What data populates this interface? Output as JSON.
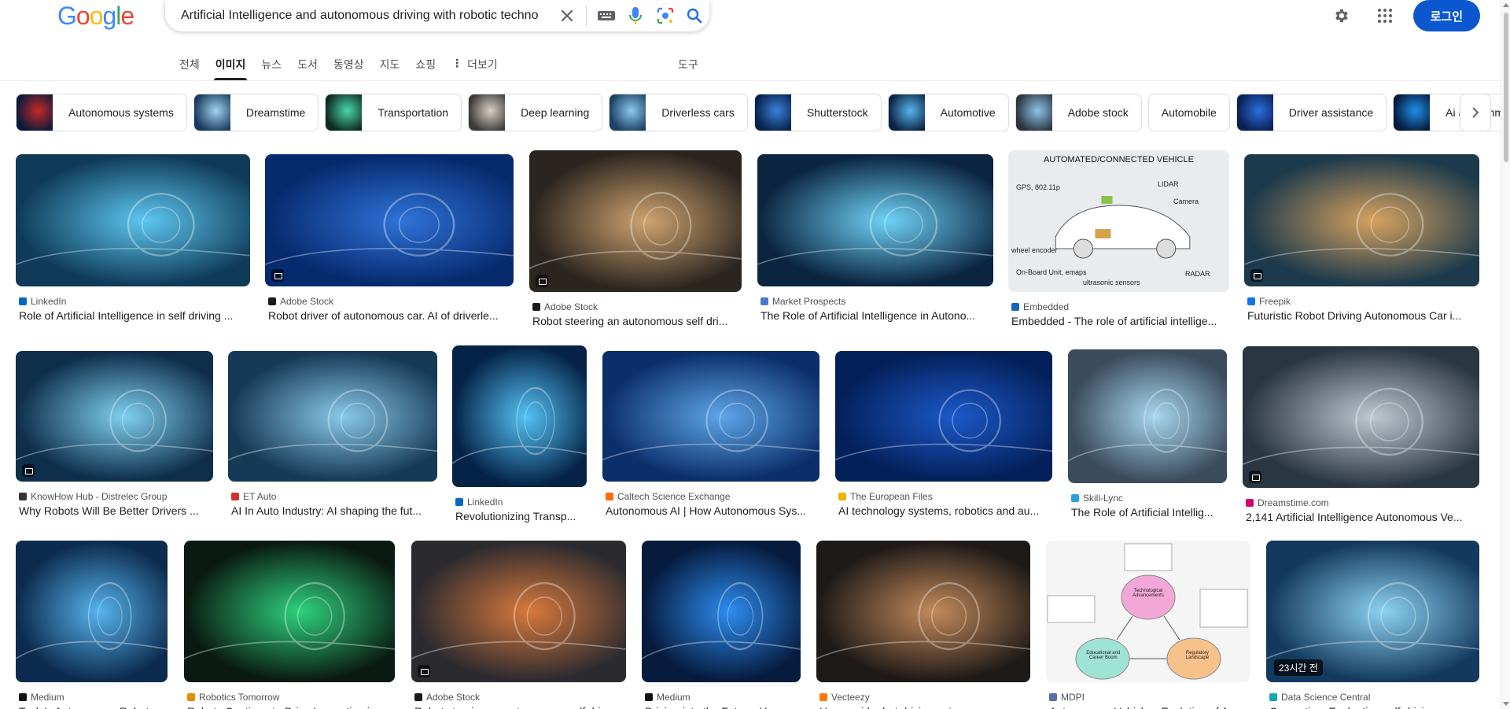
{
  "header": {
    "logo": "Google",
    "search_query": "Artificial Intelligence and autonomous driving with robotic techno",
    "login_label": "로그인"
  },
  "tabs": [
    "전체",
    "이미지",
    "뉴스",
    "도서",
    "동영상",
    "지도",
    "쇼핑",
    "더보기"
  ],
  "tools_label": "도구",
  "chips": [
    {
      "label": "Autonomous systems",
      "colors": [
        "#0b1a3a",
        "#c62828"
      ]
    },
    {
      "label": "Dreamstime",
      "colors": [
        "#1a3a5c",
        "#9fd3f0"
      ]
    },
    {
      "label": "Transportation",
      "colors": [
        "#0d2a22",
        "#4bd7a8"
      ]
    },
    {
      "label": "Deep learning",
      "colors": [
        "#3a3a3a",
        "#d9d2c4"
      ]
    },
    {
      "label": "Driverless cars",
      "colors": [
        "#1c3f63",
        "#8ac9ef"
      ]
    },
    {
      "label": "Shutterstock",
      "colors": [
        "#06214a",
        "#3b7fd9"
      ]
    },
    {
      "label": "Automotive",
      "colors": [
        "#0b2244",
        "#59b6ec"
      ]
    },
    {
      "label": "Adobe stock",
      "colors": [
        "#2a3440",
        "#8fc3e8"
      ]
    },
    {
      "label": "Automobile",
      "colors": null
    },
    {
      "label": "Driver assistance",
      "colors": [
        "#0a1f52",
        "#2a6fe0"
      ]
    },
    {
      "label": "Ai algorithms",
      "colors": [
        "#051a3d",
        "#1f8fe8"
      ]
    }
  ],
  "images": [
    {
      "source": "LinkedIn",
      "fav": "#0a66c2",
      "title": "Role of Artificial Intelligence in self driving ...",
      "colors": [
        "#0f3b59",
        "#5ec7f0"
      ],
      "badge": false
    },
    {
      "source": "Adobe Stock",
      "fav": "#1a1a1a",
      "title": "Robot driver of autonomous car. AI of driverle...",
      "colors": [
        "#062a6e",
        "#2f73d9"
      ],
      "badge": true
    },
    {
      "source": "Adobe Stock",
      "fav": "#1a1a1a",
      "title": "Robot steering an autonomous self dri...",
      "colors": [
        "#2b2520",
        "#cfa46f"
      ],
      "badge": true
    },
    {
      "source": "Market Prospects",
      "fav": "#4a7bd0",
      "title": "The Role of Artificial Intelligence in Autono...",
      "colors": [
        "#0b2540",
        "#6fd3f7"
      ],
      "badge": false
    },
    {
      "source": "Embedded",
      "fav": "#1565c0",
      "title": "Embedded - The role of artificial intellige...",
      "colors": [
        "#dfe3e6",
        "#f5f6f7"
      ],
      "badge": false,
      "diagram": true
    },
    {
      "source": "Freepik",
      "fav": "#1273eb",
      "title": "Futuristic Robot Driving Autonomous Car i...",
      "colors": [
        "#1d3a4c",
        "#d6a25e"
      ],
      "badge": true
    },
    {
      "source": "KnowHow Hub - Distrelec Group",
      "fav": "#333333",
      "title": "Why Robots Will Be Better Drivers ...",
      "colors": [
        "#0e2e4a",
        "#7fd0f0"
      ],
      "badge": true
    },
    {
      "source": "ET Auto",
      "fav": "#d32f2f",
      "title": "AI In Auto Industry: AI shaping the fut...",
      "colors": [
        "#163a55",
        "#89c9ea"
      ],
      "badge": false
    },
    {
      "source": "LinkedIn",
      "fav": "#0a66c2",
      "title": "Revolutionizing Transp...",
      "colors": [
        "#052348",
        "#54c3f5"
      ],
      "badge": false
    },
    {
      "source": "Caltech Science Exchange",
      "fav": "#ff6c0c",
      "title": "Autonomous AI | How Autonomous Sys...",
      "colors": [
        "#0b2f6b",
        "#5ea6e8"
      ],
      "badge": false
    },
    {
      "source": "The European Files",
      "fav": "#f0b400",
      "title": "AI technology systems, robotics and au...",
      "colors": [
        "#04205a",
        "#1b59c9"
      ],
      "badge": false
    },
    {
      "source": "Skill-Lync",
      "fav": "#27a3d9",
      "title": "The Role of Artificial Intellig...",
      "colors": [
        "#3a4b5c",
        "#a8d7ef"
      ],
      "badge": false
    },
    {
      "source": "Dreamstime.com",
      "fav": "#d4006e",
      "title": "2,141 Artificial Intelligence Autonomous Ve...",
      "colors": [
        "#2a3642",
        "#c0c9d2"
      ],
      "badge": true
    },
    {
      "source": "Medium",
      "fav": "#111111",
      "title": "Tesla's Autonomous Robot...",
      "colors": [
        "#0c2b4e",
        "#56b4ee"
      ],
      "badge": false
    },
    {
      "source": "Robotics Tomorrow",
      "fav": "#e58b00",
      "title": "Robots Continue to Drive Innovation in ...",
      "colors": [
        "#0a1a12",
        "#2ed27c"
      ],
      "badge": false
    },
    {
      "source": "Adobe Stock",
      "fav": "#1a1a1a",
      "title": "Robot steering an autonomous self dri...",
      "colors": [
        "#2b2a2f",
        "#d9793c"
      ],
      "badge": true
    },
    {
      "source": "Medium",
      "fav": "#111111",
      "title": "Driving into the Future: How...",
      "colors": [
        "#061b3e",
        "#2d8df0"
      ],
      "badge": false
    },
    {
      "source": "Vecteezy",
      "fav": "#ff7a00",
      "title": "Humanoid robot driving autonomous c...",
      "colors": [
        "#1e1a18",
        "#c58a5a"
      ],
      "badge": false
    },
    {
      "source": "MDPI",
      "fav": "#5b6cae",
      "title": "Autonomous Vehicles: Evolution of A...",
      "colors": [
        "#f3f4f4",
        "#f3f4f4"
      ],
      "badge": false,
      "mdpi": true
    },
    {
      "source": "Data Science Central",
      "fav": "#1aa3b8",
      "title": "Computing: Evaluating self-driving car...",
      "colors": [
        "#133a5e",
        "#8dd2f2"
      ],
      "badge": false,
      "time": "23시간 전"
    }
  ],
  "diagram_text": {
    "title": "AUTOMATED/CONNECTED VEHICLE",
    "labels": [
      "GPS, 802.11p",
      "LIDAR",
      "Camera",
      "wheel encoder",
      "On-Board Unit, emaps",
      "RADAR",
      "ultrasonic sensors"
    ]
  },
  "mdpi_text": {
    "center_top": "Technological Advancements",
    "left": "Educational and Career Boom",
    "right": "Regulatory Landscape"
  }
}
